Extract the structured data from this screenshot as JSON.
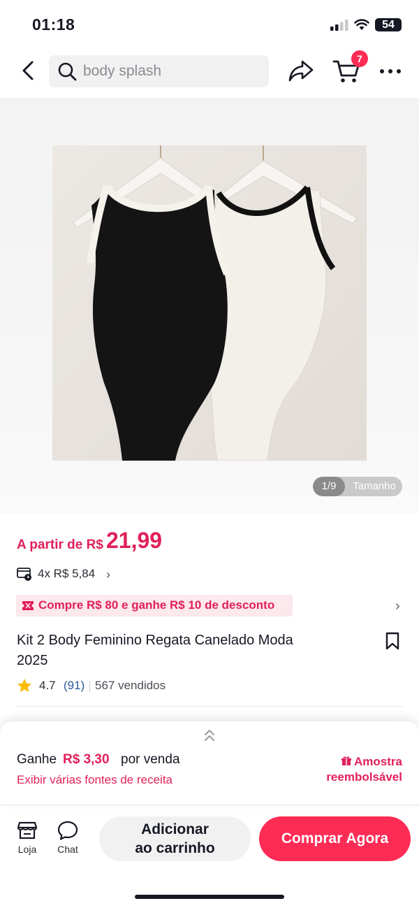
{
  "status_bar": {
    "time": "01:18",
    "battery": "54"
  },
  "header": {
    "search_text": "body splash",
    "cart_count": "7",
    "icons": [
      "back-icon",
      "search-icon",
      "share-icon",
      "cart-icon",
      "more-icon"
    ]
  },
  "gallery": {
    "counter": "1/9",
    "size_label": "Tamanho"
  },
  "price": {
    "prefix": "A partir de R$",
    "value": "21,99",
    "installments": "4x R$ 5,84"
  },
  "promo": {
    "text": "Compre R$ 80 e ganhe R$ 10 de desconto"
  },
  "product": {
    "title": "Kit 2 Body Feminino Regata Canelado Moda 2025",
    "rating": "4.7",
    "reviews": "(91)",
    "sold": "567 vendidos"
  },
  "earnings": {
    "prefix": "Ganhe",
    "amount": "R$ 3,30",
    "suffix": "por venda",
    "link": "Exibir várias fontes de receita",
    "sample_line1": "Amostra",
    "sample_line2": "reembolsável"
  },
  "bottom_bar": {
    "shop_label": "Loja",
    "chat_label": "Chat",
    "add_cart_line1": "Adicionar",
    "add_cart_line2": "ao carrinho",
    "buy_now": "Comprar Agora"
  },
  "colors": {
    "accent": "#fe2c55",
    "price": "#e0205a",
    "promo_bg": "#fde8ee"
  }
}
